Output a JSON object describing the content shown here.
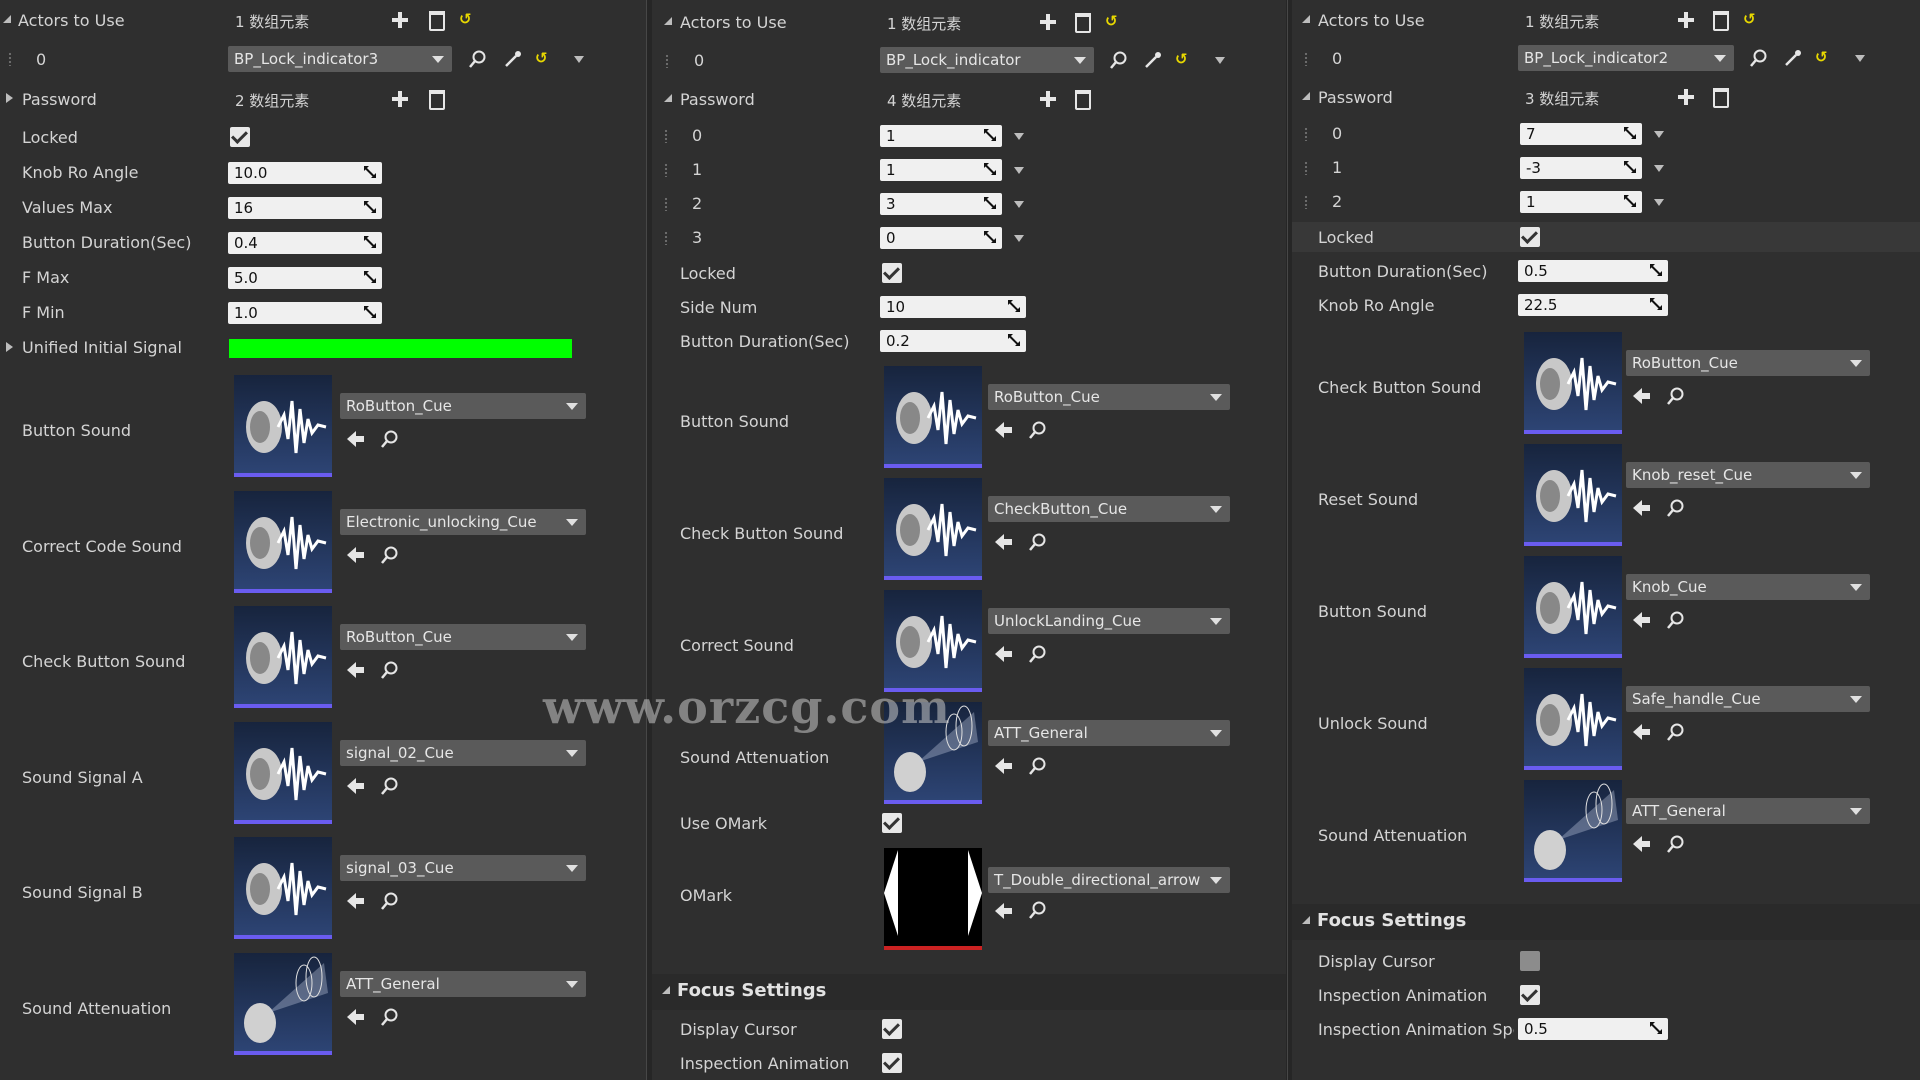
{
  "watermark": "www.orzcg.com",
  "icons": {
    "add": "plus-icon",
    "delete": "trash-icon",
    "reset": "reset-arrow-icon",
    "browse": "search-icon",
    "pick": "eyedropper-icon",
    "use": "arrow-left-icon",
    "combo": "chevron-down-icon",
    "sound": "sound-wave-icon",
    "attenuation": "attenuation-cone-icon",
    "texture": "double-arrow-texture-icon"
  },
  "colors": {
    "panel": "#2f2f2f",
    "field": "#f0f0f0",
    "combo": "#5a5a5a",
    "signal": "#00ff00",
    "reset": "#e8d800",
    "thumb_border": "#6a5cf0"
  },
  "panel1": {
    "actors_label": "Actors to Use",
    "actors_count": "1 数组元素",
    "index0": "0",
    "actor_value": "BP_Lock_indicator3",
    "password_label": "Password",
    "password_count": "2 数组元素",
    "locked_label": "Locked",
    "knob_label": "Knob Ro Angle",
    "knob_value": "10.0",
    "values_max_label": "Values Max",
    "values_max_value": "16",
    "duration_label": "Button Duration(Sec)",
    "duration_value": "0.4",
    "fmax_label": "F Max",
    "fmax_value": "5.0",
    "fmin_label": "F Min",
    "fmin_value": "1.0",
    "signal_label": "Unified Initial Signal",
    "sounds": [
      {
        "label": "Button Sound",
        "asset": "RoButton_Cue"
      },
      {
        "label": "Correct Code Sound",
        "asset": "Electronic_unlocking_Cue"
      },
      {
        "label": "Check Button Sound",
        "asset": "RoButton_Cue"
      },
      {
        "label": "Sound Signal A",
        "asset": "signal_02_Cue"
      },
      {
        "label": "Sound Signal B",
        "asset": "signal_03_Cue"
      },
      {
        "label": "Sound Attenuation",
        "asset": "ATT_General"
      }
    ]
  },
  "panel2": {
    "actors_label": "Actors to Use",
    "actors_count": "1 数组元素",
    "index0": "0",
    "actor_value": "BP_Lock_indicator",
    "password_label": "Password",
    "password_count": "4 数组元素",
    "password_items": [
      {
        "index": "0",
        "value": "1"
      },
      {
        "index": "1",
        "value": "1"
      },
      {
        "index": "2",
        "value": "3"
      },
      {
        "index": "3",
        "value": "0"
      }
    ],
    "locked_label": "Locked",
    "side_label": "Side Num",
    "side_value": "10",
    "duration_label": "Button Duration(Sec)",
    "duration_value": "0.2",
    "sounds": [
      {
        "label": "Button Sound",
        "asset": "RoButton_Cue"
      },
      {
        "label": "Check Button Sound",
        "asset": "CheckButton_Cue"
      },
      {
        "label": "Correct Sound",
        "asset": "UnlockLanding_Cue"
      },
      {
        "label": "Sound Attenuation",
        "asset": "ATT_General"
      }
    ],
    "omark_use_label": "Use OMark",
    "omark_label": "OMark",
    "omark_asset": "T_Double_directional_arrow",
    "focus_title": "Focus Settings",
    "display_cursor_label": "Display Cursor",
    "inspection_label": "Inspection Animation"
  },
  "panel3": {
    "actors_label": "Actors to Use",
    "actors_count": "1 数组元素",
    "index0": "0",
    "actor_value": "BP_Lock_indicator2",
    "password_label": "Password",
    "password_count": "3 数组元素",
    "password_items": [
      {
        "index": "0",
        "value": "7"
      },
      {
        "index": "1",
        "value": "-3"
      },
      {
        "index": "2",
        "value": "1"
      }
    ],
    "locked_label": "Locked",
    "duration_label": "Button Duration(Sec)",
    "duration_value": "0.5",
    "knob_label": "Knob Ro Angle",
    "knob_value": "22.5",
    "sounds": [
      {
        "label": "Check Button Sound",
        "asset": "RoButton_Cue"
      },
      {
        "label": "Reset Sound",
        "asset": "Knob_reset_Cue"
      },
      {
        "label": "Button Sound",
        "asset": "Knob_Cue"
      },
      {
        "label": "Unlock Sound",
        "asset": "Safe_handle_Cue"
      },
      {
        "label": "Sound Attenuation",
        "asset": "ATT_General"
      }
    ],
    "focus_title": "Focus Settings",
    "display_cursor_label": "Display Cursor",
    "inspection_label": "Inspection Animation",
    "inspection_speed_label": "Inspection Animation Speed",
    "inspection_speed_value": "0.5"
  }
}
